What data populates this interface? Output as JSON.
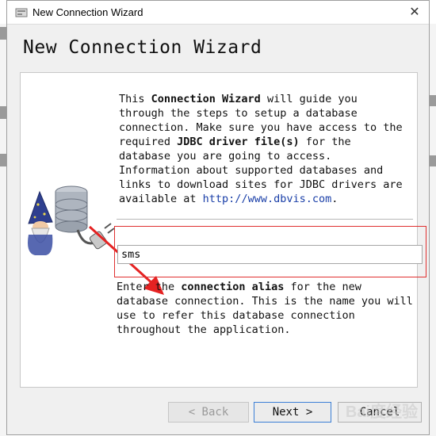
{
  "window": {
    "title": "New Connection Wizard",
    "close_glyph": "✕"
  },
  "page_title": "New Connection Wizard",
  "intro": {
    "p1": "This ",
    "b1": "Connection Wizard",
    "p2": " will guide you\nthrough the steps to setup a database\nconnection. Make sure you have access to the\nrequired ",
    "b2": "JDBC driver file(s)",
    "p3": " for the\ndatabase you are going to access.\nInformation about supported databases and\nlinks to download sites for JDBC drivers are\navailable at ",
    "link": "http://www.dbvis.com",
    "p4": "."
  },
  "alias": {
    "value": "sms"
  },
  "description": {
    "p1": "Enter the ",
    "b1": "connection alias",
    "p2": " for the new database connection. This is the name you will use to refer this database connection throughout the application."
  },
  "buttons": {
    "back": "< Back",
    "next": "Next >",
    "cancel": "Cancel"
  },
  "watermark": "Bai度经验",
  "icons": [
    "app-icon",
    "close-icon",
    "wizard-database-icon"
  ],
  "colors": {
    "highlight": "#e03030",
    "link": "#1a3fa8",
    "next_border": "#3c7fd6"
  }
}
